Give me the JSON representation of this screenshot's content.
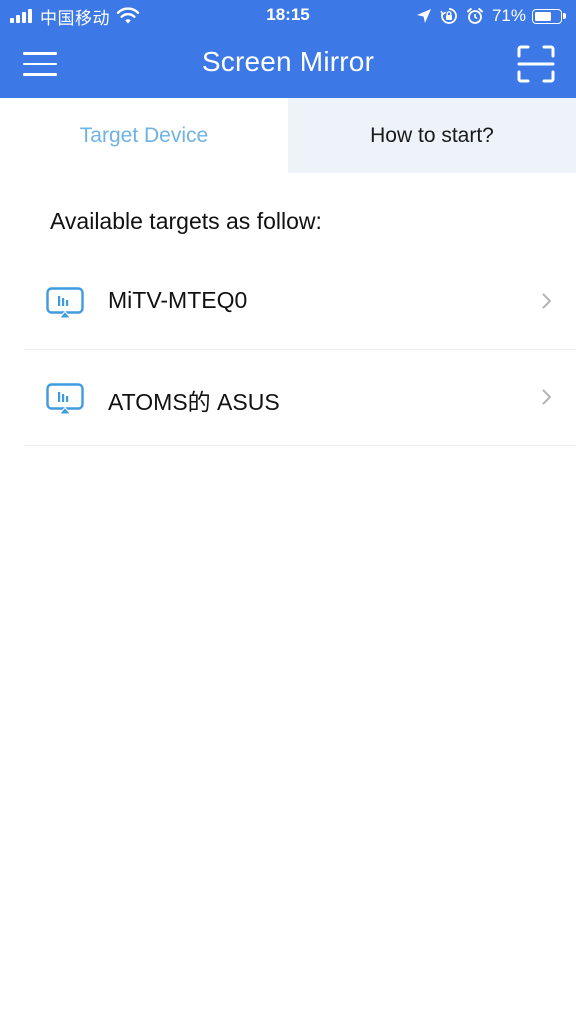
{
  "status_bar": {
    "carrier": "中国移动",
    "time": "18:15",
    "battery_percent": "71%",
    "battery_level": 0.71,
    "icons": [
      "signal-icon",
      "wifi-icon",
      "location-arrow-icon",
      "orientation-lock-icon",
      "alarm-icon",
      "battery-icon"
    ]
  },
  "nav": {
    "title": "Screen Mirror",
    "left_icon": "menu-icon",
    "right_icon": "scan-icon"
  },
  "tabs": [
    {
      "label": "Target Device",
      "active": true
    },
    {
      "label": "How to start?",
      "active": false
    }
  ],
  "main": {
    "section_title": "Available targets as follow:",
    "devices": [
      {
        "name": "MiTV-MTEQ0",
        "icon": "cast-screen-icon"
      },
      {
        "name": "ATOMS的 ASUS",
        "icon": "cast-screen-icon"
      }
    ]
  },
  "colors": {
    "header_bg": "#3c78e6",
    "active_tab_text": "#6fb3e4",
    "inactive_tab_bg": "#eef3fa",
    "device_icon": "#3d9be0"
  }
}
